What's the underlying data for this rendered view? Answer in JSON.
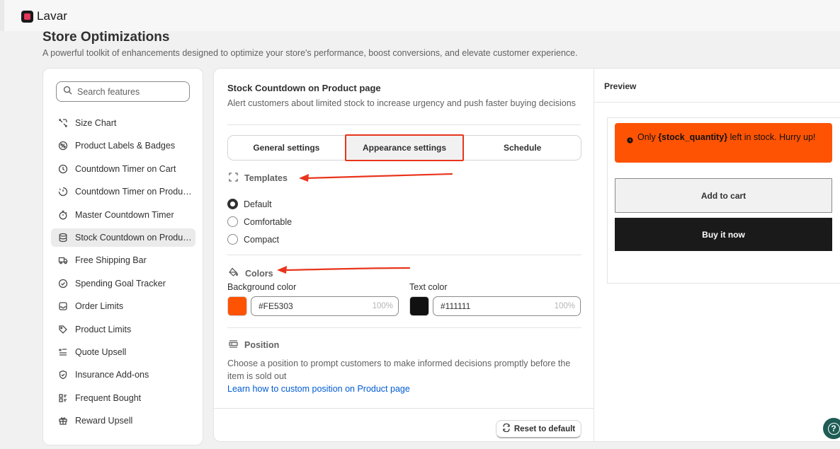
{
  "app": {
    "name": "Lavar"
  },
  "page": {
    "title": "Store Optimizations",
    "subtitle": "A powerful toolkit of enhancements designed to optimize your store's performance, boost conversions, and elevate customer experience."
  },
  "sidebar": {
    "search_placeholder": "Search features",
    "items": [
      {
        "label": "Size Chart",
        "icon": "ruler-icon"
      },
      {
        "label": "Product Labels & Badges",
        "icon": "badge-icon"
      },
      {
        "label": "Countdown Timer on Cart",
        "icon": "clock-icon"
      },
      {
        "label": "Countdown Timer on Produ…",
        "icon": "timer-icon"
      },
      {
        "label": "Master Countdown Timer",
        "icon": "stopwatch-icon"
      },
      {
        "label": "Stock Countdown on Produ…",
        "icon": "database-icon",
        "active": true
      },
      {
        "label": "Free Shipping Bar",
        "icon": "truck-icon"
      },
      {
        "label": "Spending Goal Tracker",
        "icon": "check-circle-icon"
      },
      {
        "label": "Order Limits",
        "icon": "inbox-icon"
      },
      {
        "label": "Product Limits",
        "icon": "tag-icon"
      },
      {
        "label": "Quote Upsell",
        "icon": "list-icon"
      },
      {
        "label": "Insurance Add-ons",
        "icon": "shield-icon"
      },
      {
        "label": "Frequent Bought",
        "icon": "grid-icon"
      },
      {
        "label": "Reward Upsell",
        "icon": "gift-icon"
      }
    ]
  },
  "feature": {
    "title": "Stock Countdown on Product page",
    "description": "Alert customers about limited stock to increase urgency and push faster buying decisions"
  },
  "tabs": {
    "general": "General settings",
    "appearance": "Appearance settings",
    "schedule": "Schedule",
    "selected": "appearance"
  },
  "templates": {
    "heading": "Templates",
    "options": [
      "Default",
      "Comfortable",
      "Compact"
    ],
    "selected": "Default"
  },
  "colors": {
    "heading": "Colors",
    "background_label": "Background color",
    "background_value": "#FE5303",
    "background_opacity": "100%",
    "text_label": "Text color",
    "text_value": "#111111",
    "text_opacity": "100%"
  },
  "position": {
    "heading": "Position",
    "description": "Choose a position to prompt customers to make informed decisions promptly before the item is sold out",
    "link": "Learn how to custom position on Product page"
  },
  "reset_label": "Reset to default",
  "preview": {
    "title": "Preview",
    "banner_prefix": "Only ",
    "banner_variable": "{stock_quantity}",
    "banner_suffix": " left in stock. Hurry up!",
    "add_to_cart": "Add to cart",
    "buy_now": "Buy it now"
  },
  "accent_colors": {
    "annotation_red": "#E8351C",
    "help_button": "#1E5C55"
  }
}
